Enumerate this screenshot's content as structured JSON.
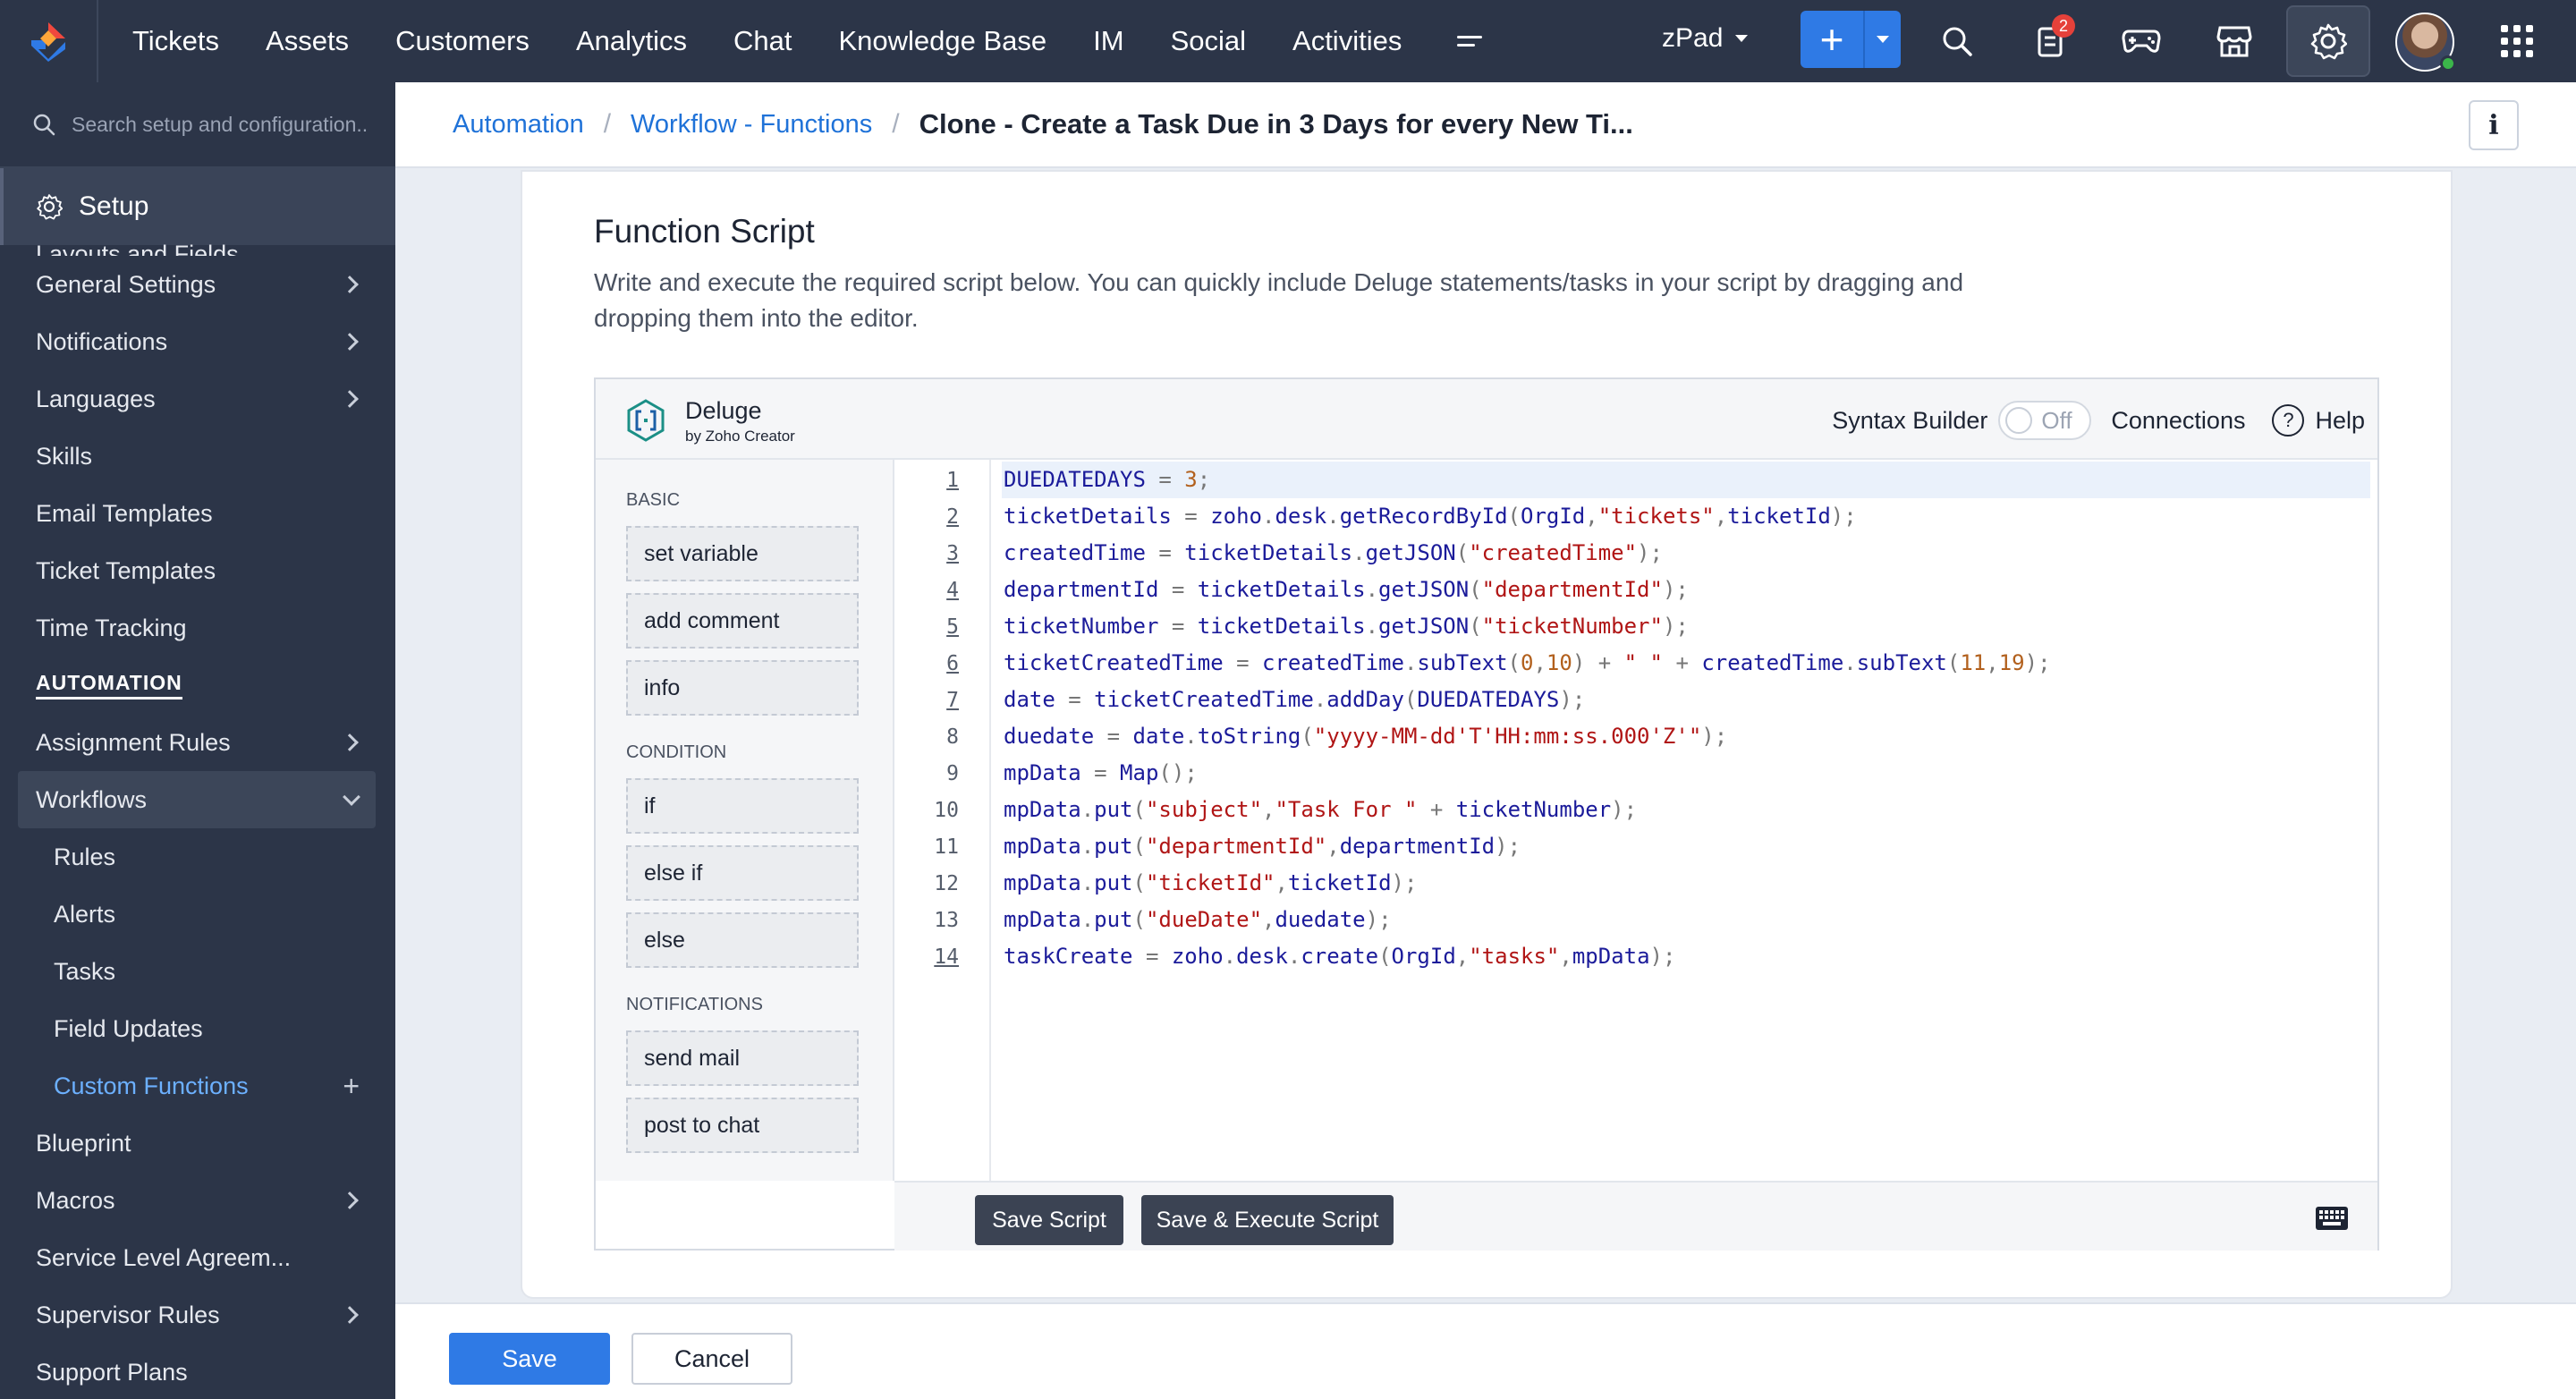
{
  "topbar": {
    "nav": [
      "Tickets",
      "Assets",
      "Customers",
      "Analytics",
      "Chat",
      "Knowledge Base",
      "IM",
      "Social",
      "Activities"
    ],
    "portal": "zPad",
    "notification_count": "2",
    "icons": [
      "zoho-desk-logo",
      "more-menu-icon",
      "plus-icon",
      "search-icon",
      "notifications-icon",
      "game-controller-icon",
      "marketplace-icon",
      "gear-icon",
      "avatar",
      "apps-grid-icon"
    ]
  },
  "sidebar": {
    "search_placeholder": "Search setup and configuration..",
    "setup_label": "Setup",
    "partial_item": "Layouts and Fields",
    "items_top": [
      "General Settings",
      "Notifications",
      "Languages",
      "Skills",
      "Email Templates",
      "Ticket Templates",
      "Time Tracking"
    ],
    "automation_heading": "AUTOMATION",
    "assignment_rules": "Assignment Rules",
    "workflows": "Workflows",
    "workflow_children": [
      "Rules",
      "Alerts",
      "Tasks",
      "Field Updates",
      "Custom Functions"
    ],
    "items_bottom": [
      "Blueprint",
      "Macros",
      "Service Level Agreem...",
      "Supervisor Rules",
      "Support Plans"
    ]
  },
  "breadcrumb": {
    "root": "Automation",
    "parent": "Workflow - Functions",
    "current": "Clone - Create a Task Due in 3 Days for every New Ti..."
  },
  "card": {
    "title": "Function Script",
    "description_line1": "Write and execute the required script below. You can quickly include Deluge statements/tasks in your script by dragging and",
    "description_line2": "dropping them into the editor."
  },
  "editor": {
    "brand": "Deluge",
    "brand_sub": "by Zoho Creator",
    "syntax_builder": "Syntax Builder",
    "toggle_state": "Off",
    "connections": "Connections",
    "help": "Help",
    "help_icon": "?",
    "palette": {
      "basic_heading": "BASIC",
      "basic": [
        "set variable",
        "add comment",
        "info"
      ],
      "condition_heading": "CONDITION",
      "condition": [
        "if",
        "else if",
        "else"
      ],
      "notifications_heading": "NOTIFICATIONS",
      "notifications": [
        "send mail",
        "post to chat"
      ]
    },
    "line_numbers": [
      "1",
      "2",
      "3",
      "4",
      "5",
      "6",
      "7",
      "8",
      "9",
      "10",
      "11",
      "12",
      "13",
      "14"
    ],
    "code": [
      "DUEDATEDAYS = 3;",
      "ticketDetails = zoho.desk.getRecordById(OrgId,\"tickets\",ticketId);",
      "createdTime = ticketDetails.getJSON(\"createdTime\");",
      "departmentId = ticketDetails.getJSON(\"departmentId\");",
      "ticketNumber = ticketDetails.getJSON(\"ticketNumber\");",
      "ticketCreatedTime = createdTime.subText(0,10) + \" \" + createdTime.subText(11,19);",
      "date = ticketCreatedTime.addDay(DUEDATEDAYS);",
      "duedate = date.toString(\"yyyy-MM-dd'T'HH:mm:ss.000'Z'\");",
      "mpData = Map();",
      "mpData.put(\"subject\",\"Task For \" + ticketNumber);",
      "mpData.put(\"departmentId\",departmentId);",
      "mpData.put(\"ticketId\",ticketId);",
      "mpData.put(\"dueDate\",duedate);",
      "taskCreate = zoho.desk.create(OrgId,\"tasks\",mpData);"
    ],
    "save_script": "Save Script",
    "save_execute": "Save & Execute Script"
  },
  "footer": {
    "save": "Save",
    "cancel": "Cancel"
  },
  "colors": {
    "topbar": "#2c3548",
    "accent": "#2f7ae5",
    "link": "#1f72d8"
  }
}
